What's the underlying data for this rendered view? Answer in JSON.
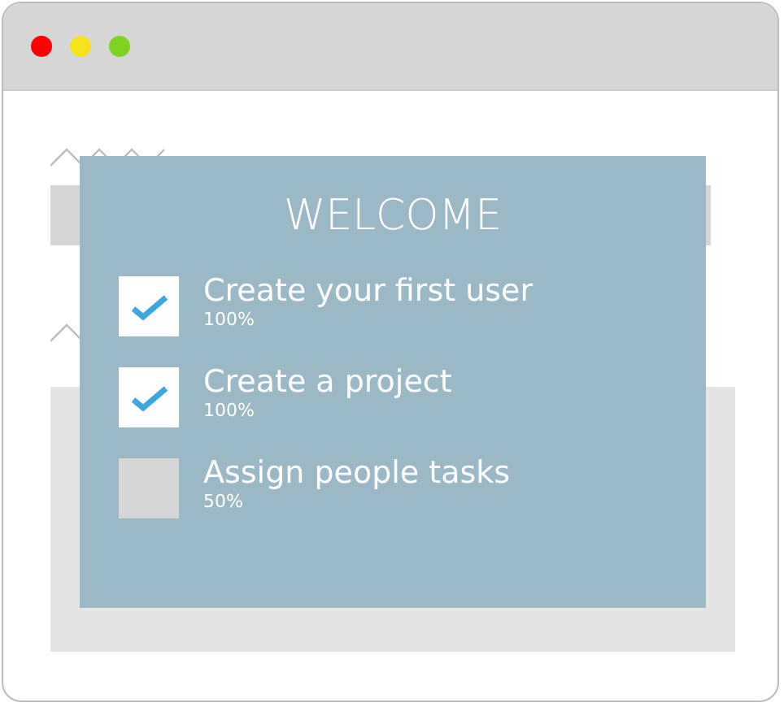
{
  "modal": {
    "title": "WELCOME",
    "tasks": [
      {
        "label": "Create your first user",
        "progress": "100%",
        "checked": true
      },
      {
        "label": "Create a project",
        "progress": "100%",
        "checked": true
      },
      {
        "label": "Assign people tasks",
        "progress": "50%",
        "checked": false
      }
    ]
  }
}
